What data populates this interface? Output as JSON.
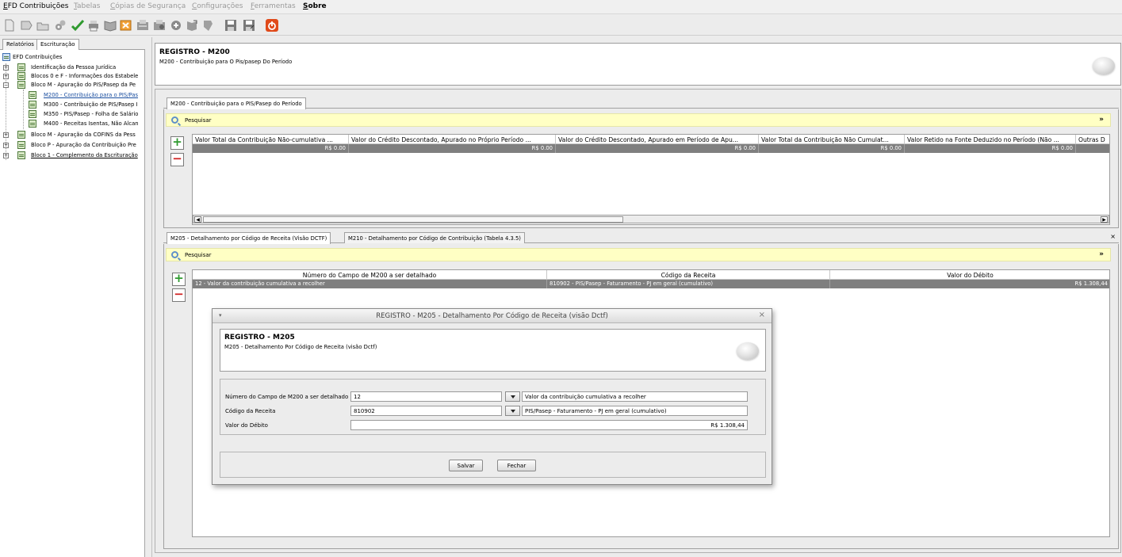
{
  "menubar": {
    "items": [
      {
        "label": "EFD Contribuições",
        "mnemonic": "E",
        "rest": "FD Contribuições",
        "enabled": true
      },
      {
        "label": "Tabelas",
        "mnemonic": "T",
        "rest": "abelas",
        "enabled": false
      },
      {
        "label": "Cópias de Segurança",
        "mnemonic": "C",
        "rest": "ópias de Segurança",
        "enabled": false
      },
      {
        "label": "Configurações",
        "mnemonic": "C",
        "rest": "onfigurações",
        "enabled": false
      },
      {
        "label": "Ferramentas",
        "mnemonic": "F",
        "rest": "erramentas",
        "enabled": false
      },
      {
        "label": "Sobre",
        "mnemonic": "S",
        "rest": "obre",
        "enabled": true
      }
    ]
  },
  "toolbar": {
    "icons": [
      "new-icon",
      "open-icon",
      "import-icon",
      "settings-icon",
      "validate-icon",
      "print-icon",
      "book-icon",
      "close-file-icon",
      "sign-icon",
      "transmit-icon",
      "receipt-icon",
      "clipboard-icon",
      "package-icon",
      "save-icon",
      "save-as-icon",
      "exit-icon"
    ]
  },
  "left": {
    "tabs": [
      "Relatórios",
      "Escrituração"
    ],
    "tree": [
      {
        "label": "EFD Contribuições",
        "level": 0,
        "style": "root"
      },
      {
        "label": "Identificação da Pessoa Jurídica",
        "level": 1,
        "expander": "+"
      },
      {
        "label": "Blocos 0 e F - Informações dos Estabele",
        "level": 1,
        "expander": "+"
      },
      {
        "label": "Bloco M - Apuração do PIS/Pasep da Pe",
        "level": 1,
        "expander": "-"
      },
      {
        "label": "M200 - Contribuição para o PIS/Pas",
        "level": 2,
        "style": "link"
      },
      {
        "label": "M300 - Contribuição de PIS/Pasep I",
        "level": 2
      },
      {
        "label": "M350 - PIS/Pasep - Folha de Salário",
        "level": 2
      },
      {
        "label": "M400 - Receitas Isentas, Não Alcan",
        "level": 2
      },
      {
        "label": "Bloco M - Apuração da COFINS da Pess",
        "level": 1,
        "expander": "+"
      },
      {
        "label": "Bloco P - Apuração da Contribuição Pre",
        "level": 1,
        "expander": "+"
      },
      {
        "label": "Bloco 1 - Complemento da Escrituração",
        "level": 1,
        "expander": "+",
        "style": "link2"
      }
    ]
  },
  "header": {
    "title": "REGISTRO - M200",
    "subtitle": "M200 - Contribuição para O Pis/pasep Do Período"
  },
  "upper": {
    "tab": "M200 - Contribuição para o PIS/Pasep do Período",
    "search_label": "Pesquisar",
    "columns": [
      "Valor Total da Contribuição Não-cumulativa ...",
      "Valor do Crédito Descontado, Apurado no Próprio Período ...",
      "Valor do Crédito Descontado, Apurado em Período de Apu...",
      "Valor Total da Contribuição Não Cumulat...",
      "Valor Retido na Fonte Deduzido no Período (Não ...",
      "Outras D"
    ],
    "row": [
      "R$ 0.00",
      "R$ 0.00",
      "R$ 0.00",
      "R$ 0.00",
      "R$ 0.00",
      ""
    ]
  },
  "lower": {
    "tabs": [
      "M205 - Detalhamento por Código de Receita (Visão DCTF)",
      "M210 - Detalhamento por Código de Contribuição (Tabela 4.3.5)"
    ],
    "close_glyph": "×",
    "search_label": "Pesquisar",
    "columns": [
      "Número do Campo de M200 a ser detalhado",
      "Código da Receita",
      "Valor do Débito"
    ],
    "row": [
      "12 - Valor da contribuição cumulativa a recolher",
      "810902 - PIS/Pasep - Faturamento - PJ em geral (cumulativo)",
      "R$ 1.308,44"
    ]
  },
  "dialog": {
    "title": "REGISTRO - M205 - Detalhamento Por Código de Receita (visão Dctf)",
    "header_title": "REGISTRO - M205",
    "header_subtitle": "M205 - Detalhamento Por Código de Receita (visão Dctf)",
    "fields": {
      "campo_label": "Número do Campo de M200 a ser detalhado",
      "campo_value": "12",
      "campo_desc": "Valor da contribuição cumulativa a recolher",
      "codigo_label": "Código da Receita",
      "codigo_value": "810902",
      "codigo_desc": "PIS/Pasep - Faturamento - PJ em geral (cumulativo)",
      "valor_label": "Valor do Débito",
      "valor_value": "R$ 1.308,44"
    },
    "buttons": {
      "save": "Salvar",
      "close": "Fechar"
    }
  },
  "colors": {
    "search_bg": "#ffffc4",
    "selected_row": "#7f7f7f",
    "add": "#2f9a2f",
    "remove": "#d02020",
    "exit": "#e04a1a"
  }
}
